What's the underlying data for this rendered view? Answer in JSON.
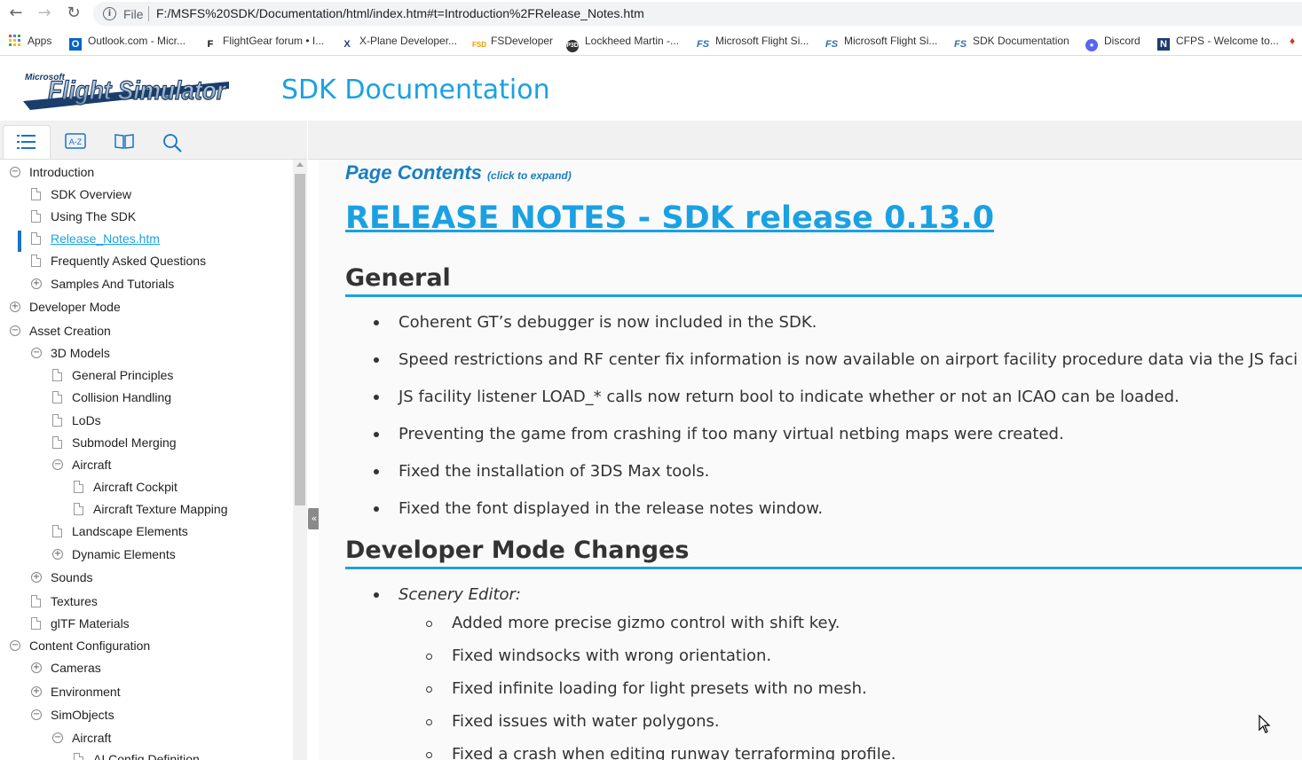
{
  "browser": {
    "file_label": "File",
    "url": "F:/MSFS%20SDK/Documentation/html/index.htm#t=Introduction%2FRelease_Notes.htm",
    "bookmarks": [
      {
        "label": "Apps",
        "icon": "apps-grid-icon"
      },
      {
        "label": "Outlook.com - Micr...",
        "icon": "outlook-icon"
      },
      {
        "label": "FlightGear forum • I...",
        "icon": "flightgear-icon"
      },
      {
        "label": "X-Plane Developer...",
        "icon": "xplane-icon"
      },
      {
        "label": "FSDeveloper",
        "icon": "fsdeveloper-icon"
      },
      {
        "label": "Lockheed Martin -...",
        "icon": "lockheed-icon"
      },
      {
        "label": "Microsoft Flight Si...",
        "icon": "msfs-icon"
      },
      {
        "label": "Microsoft Flight Si...",
        "icon": "msfs-icon"
      },
      {
        "label": "SDK Documentation",
        "icon": "msfs-icon"
      },
      {
        "label": "Discord",
        "icon": "discord-icon"
      },
      {
        "label": "CFPS - Welcome to...",
        "icon": "cfps-icon"
      }
    ]
  },
  "header": {
    "logo_small": "Microsoft",
    "logo_main": "Flight Simulator",
    "title": "SDK Documentation"
  },
  "sidebar": {
    "tabs": [
      "toc-tab",
      "index-tab",
      "glossary-tab",
      "search-tab"
    ],
    "tree": [
      {
        "label": "Introduction",
        "level": 0,
        "kind": "collapse"
      },
      {
        "label": "SDK Overview",
        "level": 1,
        "kind": "doc"
      },
      {
        "label": "Using The SDK",
        "level": 1,
        "kind": "doc"
      },
      {
        "label": "Release_Notes.htm",
        "level": 1,
        "kind": "doc",
        "current": true
      },
      {
        "label": "Frequently Asked Questions",
        "level": 1,
        "kind": "doc"
      },
      {
        "label": "Samples And Tutorials",
        "level": 1,
        "kind": "expand"
      },
      {
        "label": "Developer Mode",
        "level": 0,
        "kind": "expand"
      },
      {
        "label": "Asset Creation",
        "level": 0,
        "kind": "collapse"
      },
      {
        "label": "3D Models",
        "level": 1,
        "kind": "collapse"
      },
      {
        "label": "General Principles",
        "level": 2,
        "kind": "doc"
      },
      {
        "label": "Collision Handling",
        "level": 2,
        "kind": "doc"
      },
      {
        "label": "LoDs",
        "level": 2,
        "kind": "doc"
      },
      {
        "label": "Submodel Merging",
        "level": 2,
        "kind": "doc"
      },
      {
        "label": "Aircraft",
        "level": 2,
        "kind": "collapse"
      },
      {
        "label": "Aircraft Cockpit",
        "level": 3,
        "kind": "doc"
      },
      {
        "label": "Aircraft Texture Mapping",
        "level": 3,
        "kind": "doc"
      },
      {
        "label": "Landscape Elements",
        "level": 2,
        "kind": "doc"
      },
      {
        "label": "Dynamic Elements",
        "level": 2,
        "kind": "expand"
      },
      {
        "label": "Sounds",
        "level": 1,
        "kind": "expand"
      },
      {
        "label": "Textures",
        "level": 1,
        "kind": "doc"
      },
      {
        "label": "glTF Materials",
        "level": 1,
        "kind": "doc"
      },
      {
        "label": "Content Configuration",
        "level": 0,
        "kind": "collapse"
      },
      {
        "label": "Cameras",
        "level": 1,
        "kind": "expand"
      },
      {
        "label": "Environment",
        "level": 1,
        "kind": "expand"
      },
      {
        "label": "SimObjects",
        "level": 1,
        "kind": "collapse"
      },
      {
        "label": "Aircraft",
        "level": 2,
        "kind": "collapse"
      },
      {
        "label": "AI Config Definition",
        "level": 3,
        "kind": "doc"
      }
    ]
  },
  "content": {
    "page_contents": "Page Contents",
    "page_contents_hint": "(click to expand)",
    "release_title": "RELEASE NOTES - SDK release 0.13.0",
    "general_heading": "General",
    "general_items": [
      "Coherent GT’s debugger is now included in the SDK.",
      "Speed restrictions and RF center fix information is now available on airport facility procedure data via the JS faci",
      "JS facility listener LOAD_* calls now return bool to indicate whether or not an ICAO can be loaded.",
      "Preventing the game from crashing if too many virtual netbing maps were created.",
      "Fixed the installation of 3DS Max tools.",
      "Fixed the font displayed in the release notes window."
    ],
    "devmode_heading": "Developer Mode Changes",
    "scenery_editor_label": "Scenery Editor:",
    "scenery_items": [
      "Added more precise gizmo control with shift key.",
      "Fixed windsocks with wrong orientation.",
      "Fixed infinite loading for light presets with no mesh.",
      "Fixed issues with water polygons.",
      "Fixed a crash when editing runway terraforming profile."
    ]
  },
  "colors": {
    "accent": "#1ba1e2",
    "link_dark": "#1a7fc1",
    "current_marker": "#1a73c8"
  }
}
